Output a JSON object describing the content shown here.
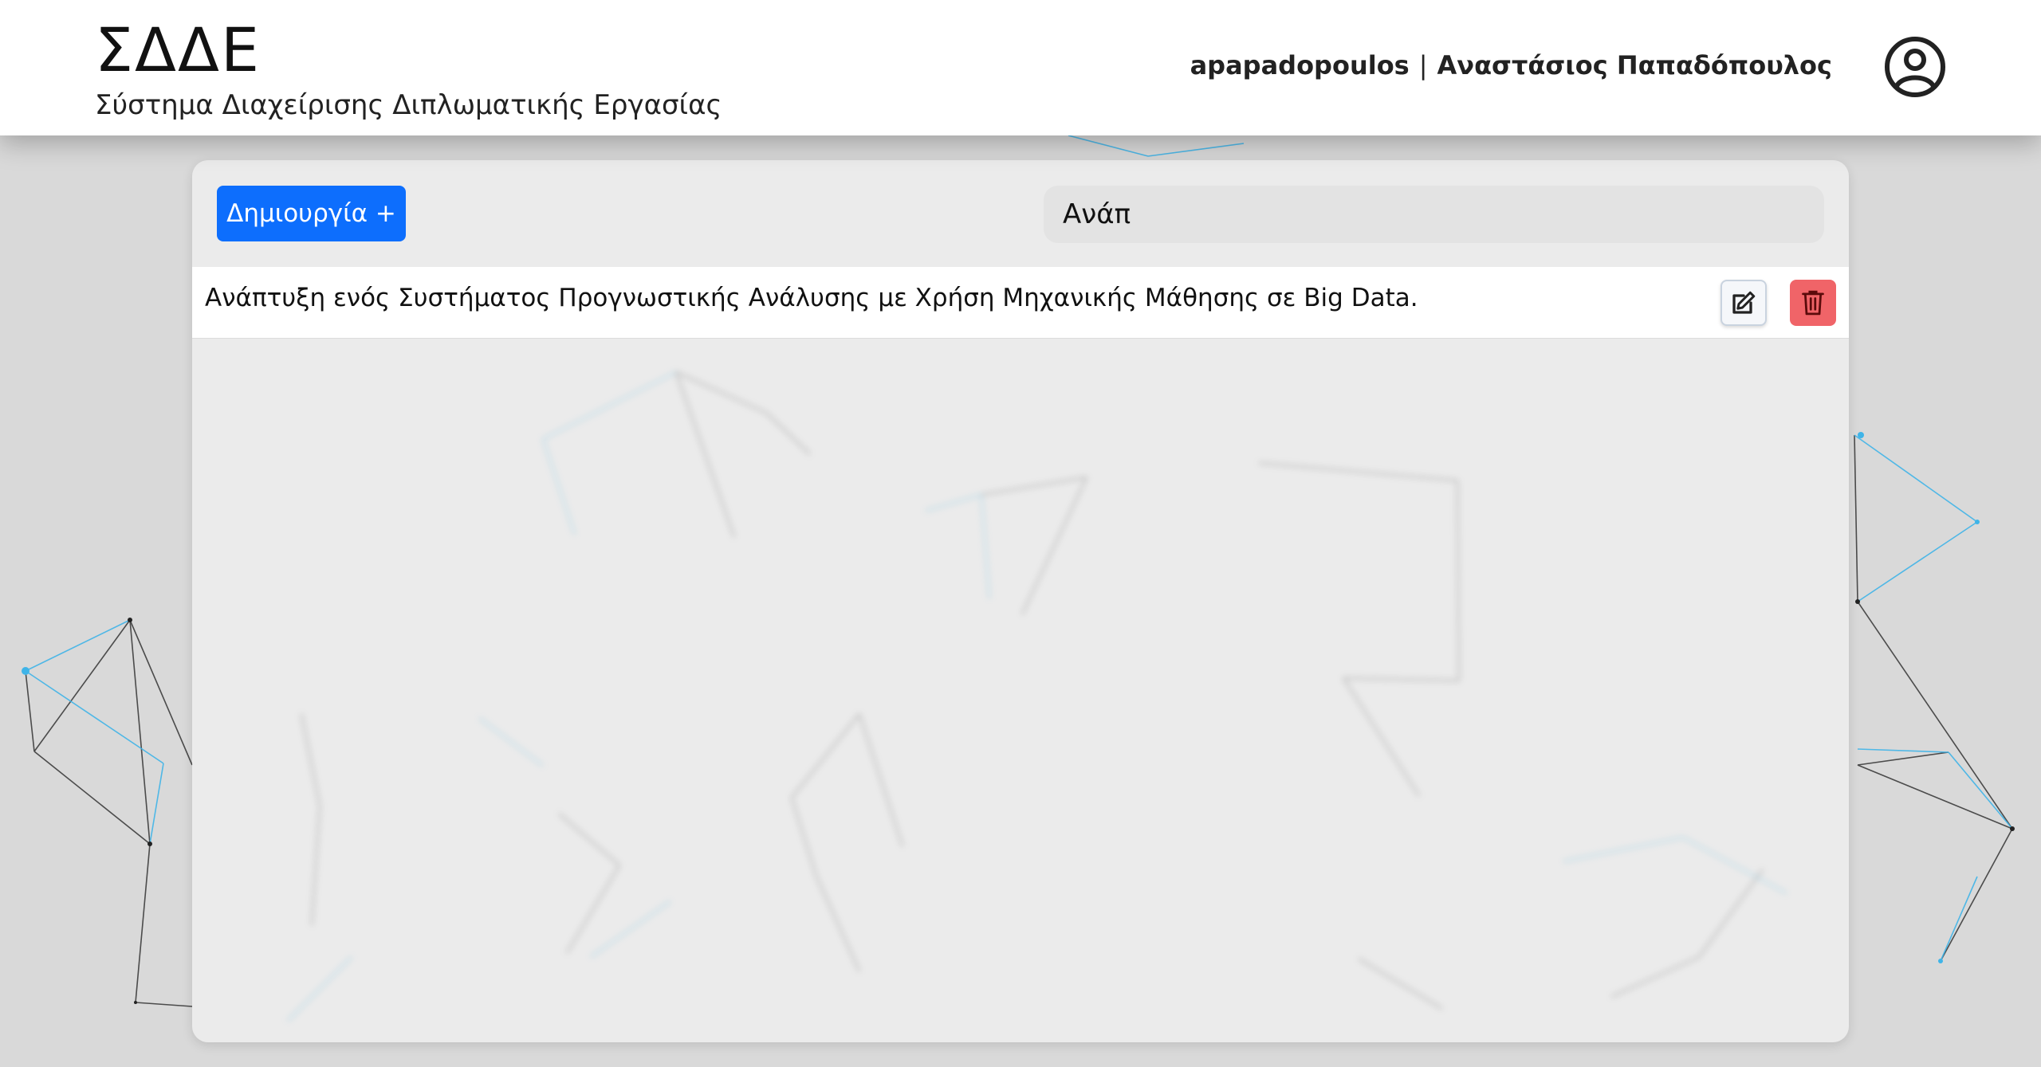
{
  "header": {
    "brand_title": "ΣΔΔΕ",
    "brand_subtitle": "Σύστημα Διαχείρισης Διπλωματικής Εργασίας",
    "username": "apapadopoulos",
    "separator": "|",
    "full_name": "Αναστάσιος Παπαδόπουλος",
    "avatar_icon": "user-circle-icon"
  },
  "toolbar": {
    "create_label": "Δημιουργία +",
    "search_value": "Ανάπ",
    "search_placeholder": ""
  },
  "list": {
    "items": [
      {
        "title": "Ανάπτυξη ενός Συστήματος Προγνωστικής Ανάλυσης με Χρήση Μηχανικής Μάθησης σε Big Data.",
        "edit_icon": "edit-icon",
        "delete_icon": "trash-icon"
      }
    ]
  },
  "colors": {
    "primary": "#0d6efd",
    "danger": "#f06468",
    "network_blue": "#3fb4e8",
    "network_dark": "#333333"
  }
}
